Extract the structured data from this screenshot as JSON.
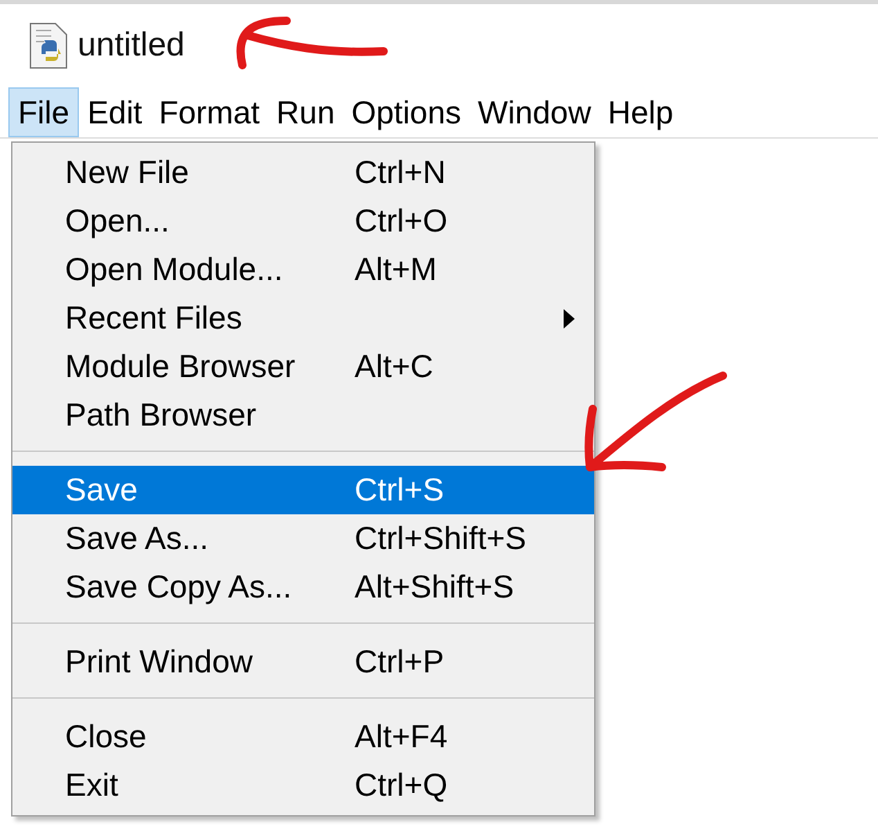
{
  "window": {
    "title": "untitled"
  },
  "menubar": [
    {
      "label": "File",
      "selected": true
    },
    {
      "label": "Edit",
      "selected": false
    },
    {
      "label": "Format",
      "selected": false
    },
    {
      "label": "Run",
      "selected": false
    },
    {
      "label": "Options",
      "selected": false
    },
    {
      "label": "Window",
      "selected": false
    },
    {
      "label": "Help",
      "selected": false
    }
  ],
  "file_menu": [
    {
      "kind": "item",
      "label": "New File",
      "shortcut": "Ctrl+N",
      "selected": false
    },
    {
      "kind": "item",
      "label": "Open...",
      "shortcut": "Ctrl+O",
      "selected": false
    },
    {
      "kind": "item",
      "label": "Open Module...",
      "shortcut": "Alt+M",
      "selected": false
    },
    {
      "kind": "submenu",
      "label": "Recent Files",
      "selected": false
    },
    {
      "kind": "item",
      "label": "Module Browser",
      "shortcut": "Alt+C",
      "selected": false
    },
    {
      "kind": "item",
      "label": "Path Browser",
      "selected": false
    },
    {
      "kind": "separator"
    },
    {
      "kind": "item",
      "label": "Save",
      "shortcut": "Ctrl+S",
      "selected": true
    },
    {
      "kind": "item",
      "label": "Save As...",
      "shortcut": "Ctrl+Shift+S",
      "selected": false
    },
    {
      "kind": "item",
      "label": "Save Copy As...",
      "shortcut": "Alt+Shift+S",
      "selected": false
    },
    {
      "kind": "separator"
    },
    {
      "kind": "item",
      "label": "Print Window",
      "shortcut": "Ctrl+P",
      "selected": false
    },
    {
      "kind": "separator"
    },
    {
      "kind": "item",
      "label": "Close",
      "shortcut": "Alt+F4",
      "selected": false
    },
    {
      "kind": "item",
      "label": "Exit",
      "shortcut": "Ctrl+Q",
      "selected": false
    }
  ]
}
